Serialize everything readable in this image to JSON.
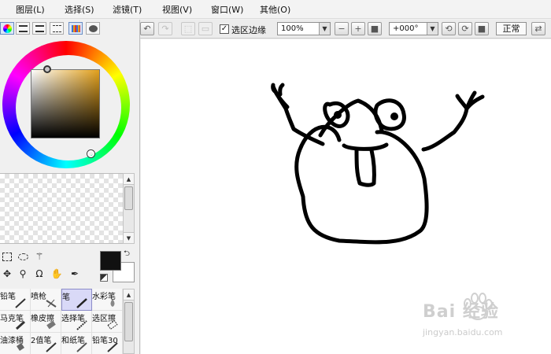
{
  "menu": [
    {
      "label": "图层(L)"
    },
    {
      "label": "选择(S)"
    },
    {
      "label": "滤镜(T)"
    },
    {
      "label": "视图(V)"
    },
    {
      "label": "窗口(W)"
    },
    {
      "label": "其他(O)"
    }
  ],
  "toolbar": {
    "selection_edge_label": "选区边缘",
    "selection_edge_checked": true,
    "zoom_value": "100%",
    "rotation_value": "+000°",
    "mode_label": "正常"
  },
  "colors": {
    "foreground": "#111111",
    "background": "#ffffff",
    "selected_hue": "#e3a11c"
  },
  "brush_tools": [
    {
      "label": "铅笔",
      "icon": "pencil-icon"
    },
    {
      "label": "喷枪",
      "icon": "airbrush-icon"
    },
    {
      "label": "笔",
      "icon": "pen-icon",
      "selected": true
    },
    {
      "label": "水彩笔",
      "icon": "watercolor-icon"
    },
    {
      "label": "马克笔",
      "icon": "marker-icon"
    },
    {
      "label": "橡皮擦",
      "icon": "eraser-icon"
    },
    {
      "label": "选择笔",
      "icon": "selection-pen-icon"
    },
    {
      "label": "选区擦",
      "icon": "selection-eraser-icon"
    },
    {
      "label": "油漆桶",
      "icon": "paint-bucket-icon"
    },
    {
      "label": "2值笔",
      "icon": "binary-pen-icon"
    },
    {
      "label": "和纸笔",
      "icon": "washi-pen-icon"
    },
    {
      "label": "铅笔30",
      "icon": "pencil-30-icon"
    }
  ],
  "watermark": {
    "logo": "Bai 经验",
    "url": "jingyan.baidu.com"
  }
}
